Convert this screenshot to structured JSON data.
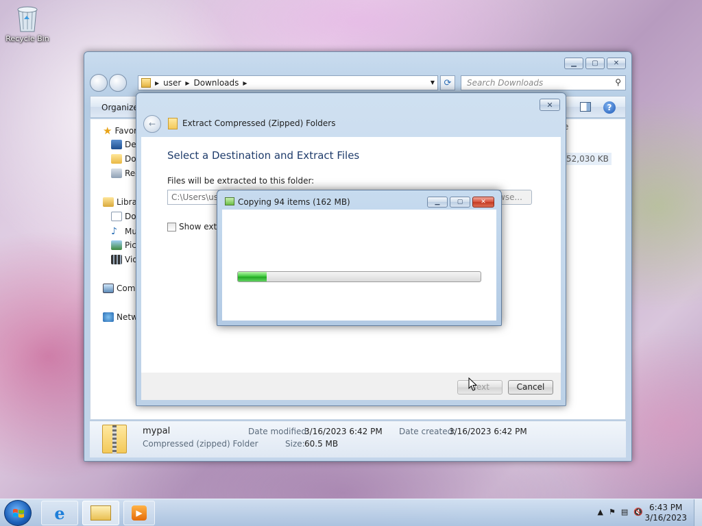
{
  "desktop": {
    "recycle_bin_label": "Recycle Bin"
  },
  "explorer": {
    "address": [
      "user",
      "Downloads"
    ],
    "search_placeholder": "Search Downloads",
    "toolbar_organize": "Organize",
    "nav_items": [
      {
        "label": "Favor",
        "icon": "star-icon"
      },
      {
        "label": "Des",
        "icon": "desktop-icon"
      },
      {
        "label": "Dov",
        "icon": "downloads-folder-icon"
      },
      {
        "label": "Rec",
        "icon": "recent-places-icon"
      },
      {
        "label": "Libra",
        "icon": "libraries-icon"
      },
      {
        "label": "Doc",
        "icon": "documents-icon"
      },
      {
        "label": "Mu",
        "icon": "music-icon"
      },
      {
        "label": "Pic",
        "icon": "pictures-icon"
      },
      {
        "label": "Vid",
        "icon": "videos-icon"
      },
      {
        "label": "Com",
        "icon": "computer-icon"
      },
      {
        "label": "Netw",
        "icon": "network-icon"
      }
    ],
    "column_partial": "e",
    "size_partial": "52,030 KB",
    "details": {
      "name": "mypal",
      "type": "Compressed (zipped) Folder",
      "modified_label": "Date modified:",
      "modified_value": "3/16/2023 6:42 PM",
      "size_label": "Size:",
      "size_value": "60.5 MB",
      "created_label": "Date created:",
      "created_value": "3/16/2023 6:42 PM"
    }
  },
  "extract": {
    "title": "Extract Compressed (Zipped) Folders",
    "heading": "Select a Destination and Extract Files",
    "sub": "Files will be extracted to this folder:",
    "path": "C:\\Users\\use",
    "browse": "wse...",
    "checkbox_label": "Show extra",
    "next": "Next",
    "cancel": "Cancel"
  },
  "copying": {
    "title": "Copying 94 items (162 MB)",
    "progress_fraction": 0.12
  },
  "taskbar": {
    "time": "6:43 PM",
    "date": "3/16/2023"
  },
  "colors": {
    "accent": "#1f3c6b",
    "progress_green": "#22a822"
  }
}
